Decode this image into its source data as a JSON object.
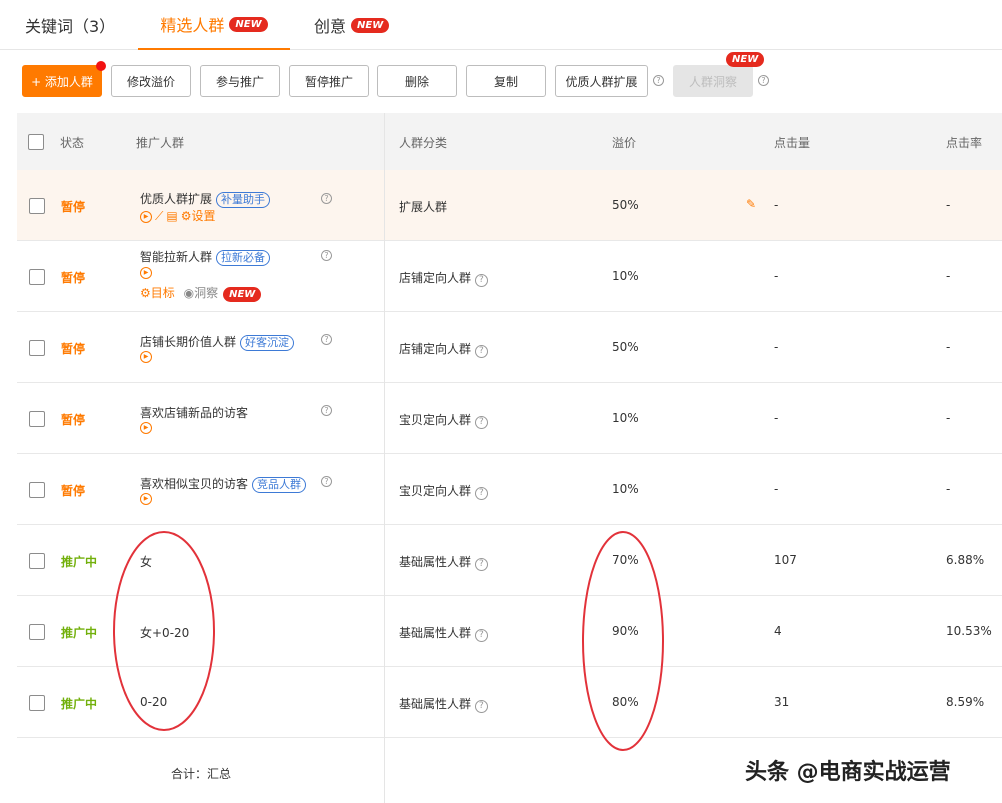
{
  "tabs": [
    {
      "label": "关键词（3）",
      "active": false
    },
    {
      "label": "精选人群",
      "active": true,
      "badge": "NEW"
    },
    {
      "label": "创意",
      "active": false,
      "badge": "NEW"
    }
  ],
  "toolbar": {
    "add": "+ 添加人群",
    "modify": "修改溢价",
    "join": "参与推广",
    "pause": "暂停推广",
    "delete": "删除",
    "copy": "复制",
    "expand": "优质人群扩展",
    "insight": "人群洞察",
    "insight_badge": "NEW"
  },
  "table": {
    "headers": {
      "status": "状态",
      "crowd": "推广人群",
      "category": "人群分类",
      "premium": "溢价",
      "clicks": "点击量",
      "ctr": "点击率"
    },
    "rows": [
      {
        "status": "暂停",
        "name": "优质人群扩展",
        "tag": "补量助手",
        "category": "扩展人群",
        "premium": "50%",
        "clicks": "-",
        "ctr": "-",
        "extra": "设置"
      },
      {
        "status": "暂停",
        "name": "智能拉新人群",
        "tag": "拉新必备",
        "category": "店铺定向人群",
        "premium": "10%",
        "clicks": "-",
        "ctr": "-",
        "extra": "目标",
        "extra2": "洞察",
        "extra_badge": "NEW"
      },
      {
        "status": "暂停",
        "name": "店铺长期价值人群",
        "tag": "好客沉淀",
        "category": "店铺定向人群",
        "premium": "50%",
        "clicks": "-",
        "ctr": "-"
      },
      {
        "status": "暂停",
        "name": "喜欢店铺新品的访客",
        "category": "宝贝定向人群",
        "premium": "10%",
        "clicks": "-",
        "ctr": "-"
      },
      {
        "status": "暂停",
        "name": "喜欢相似宝贝的访客",
        "tag": "竞品人群",
        "category": "宝贝定向人群",
        "premium": "10%",
        "clicks": "-",
        "ctr": "-"
      },
      {
        "status": "推广中",
        "name": "女",
        "category": "基础属性人群",
        "premium": "70%",
        "clicks": "107",
        "ctr": "6.88%"
      },
      {
        "status": "推广中",
        "name": "女+0-20",
        "category": "基础属性人群",
        "premium": "90%",
        "clicks": "4",
        "ctr": "10.53%"
      },
      {
        "status": "推广中",
        "name": "0-20",
        "category": "基础属性人群",
        "premium": "80%",
        "clicks": "31",
        "ctr": "8.59%"
      }
    ],
    "footer": "合计：汇总"
  },
  "watermark": "头条 @电商实战运营"
}
